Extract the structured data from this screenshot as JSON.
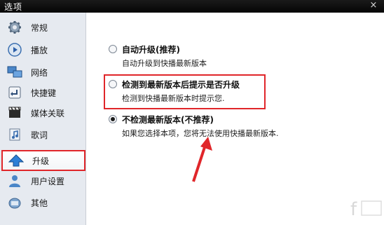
{
  "window": {
    "title": "选项",
    "close_glyph": "×"
  },
  "sidebar": {
    "items": [
      {
        "label": "常规",
        "icon": "gear-icon"
      },
      {
        "label": "播放",
        "icon": "play-icon"
      },
      {
        "label": "网络",
        "icon": "network-icon"
      },
      {
        "label": "快捷键",
        "icon": "shortcut-icon"
      },
      {
        "label": "媒体关联",
        "icon": "media-icon"
      },
      {
        "label": "歌词",
        "icon": "lyrics-icon"
      },
      {
        "label": "升级",
        "icon": "upgrade-icon",
        "selected": true
      },
      {
        "label": "用户设置",
        "icon": "user-icon"
      },
      {
        "label": "其他",
        "icon": "other-icon"
      }
    ]
  },
  "upgrade": {
    "options": [
      {
        "title": "自动升级(推荐)",
        "desc": "自动升级到快播最新版本",
        "selected": false
      },
      {
        "title": "检测到最新版本后提示是否升级",
        "desc": "检测到快播最新版本时提示您.",
        "selected": false
      },
      {
        "title": "不检测最新版本(不推荐)",
        "desc": "如果您选择本项，您将无法使用快播最新版本.",
        "selected": true
      }
    ]
  },
  "colors": {
    "highlight": "#e0262a",
    "titlebar": "#0b0b0b",
    "sidebar_bg": "#e6eaf0"
  }
}
